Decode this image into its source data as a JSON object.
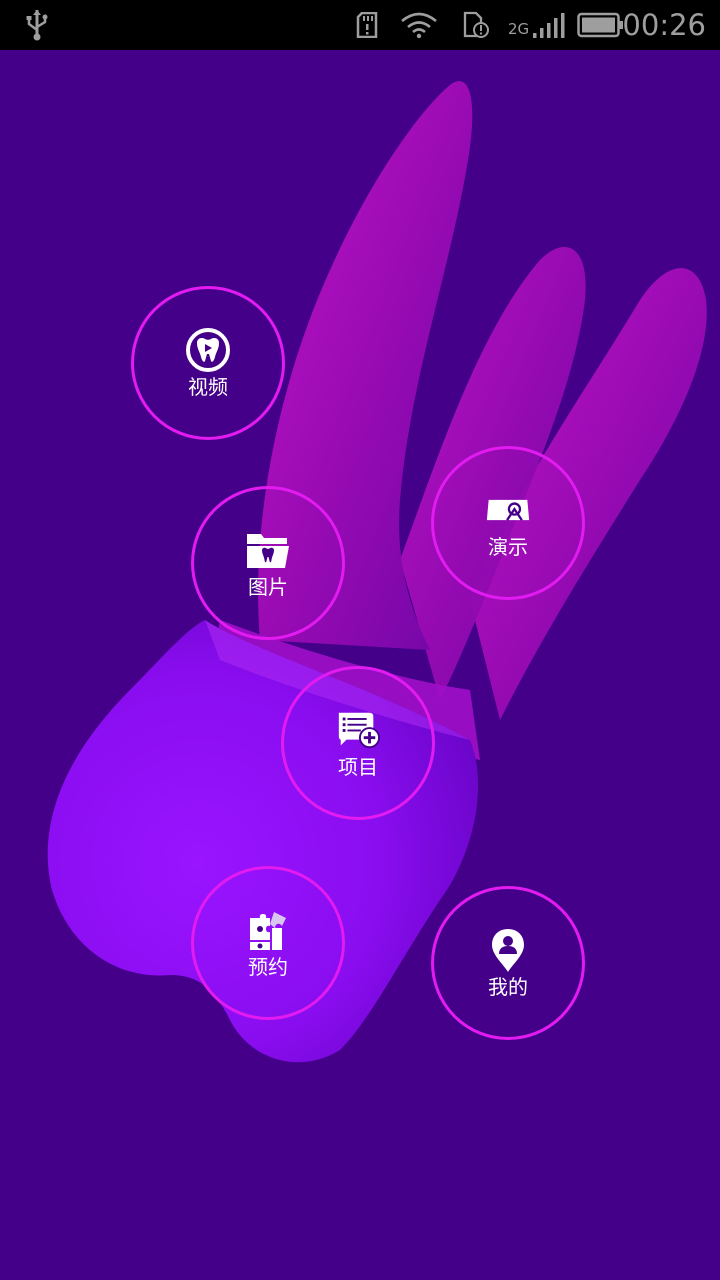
{
  "status_bar": {
    "time": "00:26",
    "network_type": "2G",
    "icons": [
      "usb-icon",
      "sd-card-icon",
      "wifi-icon",
      "sim-alert-icon",
      "signal-icon",
      "battery-icon"
    ]
  },
  "colors": {
    "background": "#45008a",
    "ring": "#e21bf0",
    "label": "#ffffff"
  },
  "menu": {
    "video": {
      "label": "视频",
      "icon": "tooth-play-icon"
    },
    "picture": {
      "label": "图片",
      "icon": "tooth-folder-icon"
    },
    "demo": {
      "label": "演示",
      "icon": "presentation-icon"
    },
    "project": {
      "label": "项目",
      "icon": "list-add-icon"
    },
    "appointment": {
      "label": "预约",
      "icon": "puzzle-icon"
    },
    "mine": {
      "label": "我的",
      "icon": "profile-pin-icon"
    }
  }
}
